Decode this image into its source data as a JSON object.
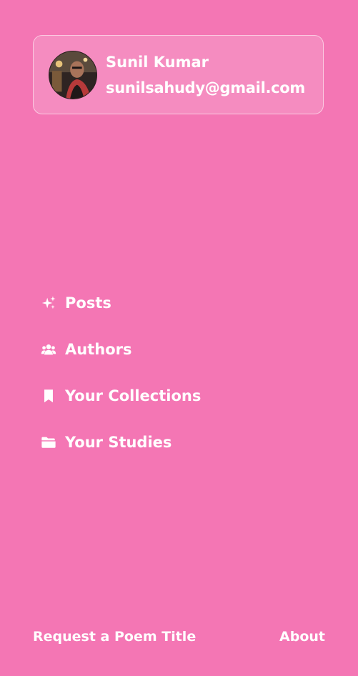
{
  "colors": {
    "background": "#F476B4",
    "text": "#FFFFFF"
  },
  "profile": {
    "name": "Sunil Kumar",
    "email": "sunilsahudy@gmail.com",
    "avatar_icon": "user-avatar-photo"
  },
  "nav": {
    "items": [
      {
        "label": "Posts",
        "icon": "sparkles-icon"
      },
      {
        "label": "Authors",
        "icon": "users-icon"
      },
      {
        "label": "Your Collections",
        "icon": "bookmark-icon"
      },
      {
        "label": "Your Studies",
        "icon": "folder-open-icon"
      }
    ]
  },
  "footer": {
    "request_label": "Request a Poem Title",
    "about_label": "About"
  }
}
